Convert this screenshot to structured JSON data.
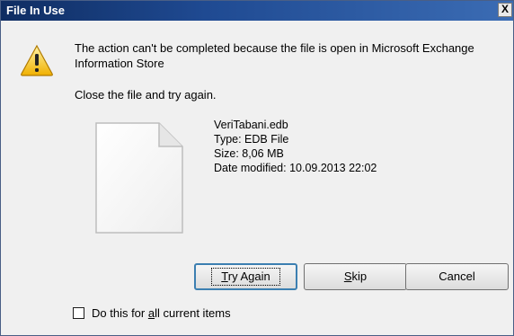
{
  "window": {
    "title": "File In Use",
    "close_glyph": "X"
  },
  "message": {
    "line1": "The action can't be completed because the file is open in Microsoft Exchange",
    "line2": "Information Store",
    "hint": "Close the file and try again."
  },
  "file": {
    "name": "VeriTabani.edb",
    "type": "Type: EDB File",
    "size": "Size: 8,06 MB",
    "modified": "Date modified: 10.09.2013 22:02"
  },
  "buttons": {
    "try_again_pre": "",
    "try_again_mnemonic": "T",
    "try_again_rest": "ry Again",
    "skip_mnemonic": "S",
    "skip_rest": "kip",
    "cancel": "Cancel"
  },
  "checkbox": {
    "label_pre": "Do this for ",
    "label_mnemonic": "a",
    "label_rest": "ll current items",
    "checked": false
  },
  "icons": {
    "warning": "warning-icon",
    "file": "document-icon"
  },
  "colors": {
    "titlebar": "#1f4a92",
    "default_button_border": "#3c7fb1"
  }
}
